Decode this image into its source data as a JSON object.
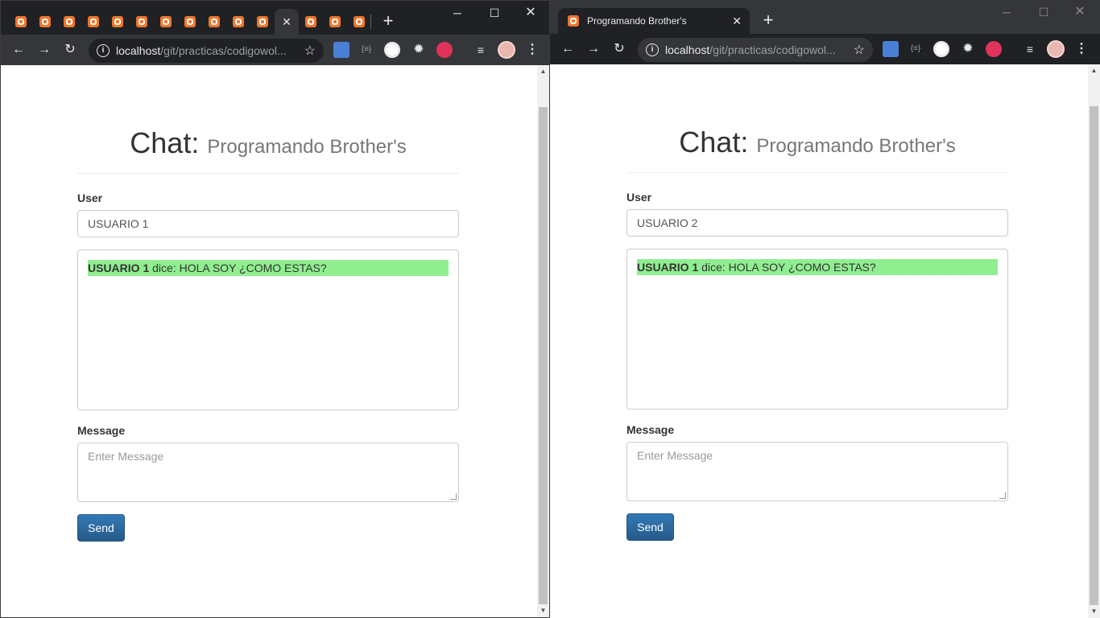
{
  "left_window": {
    "tab_close_glyph": "✕",
    "new_tab_glyph": "+",
    "window_controls": {
      "minimize": "─",
      "maximize": "☐",
      "close": "✕"
    },
    "address": {
      "host": "localhost",
      "path": "/git/practicas/codigowol..."
    },
    "page": {
      "title": "Chat:",
      "title_small": "Programando Brother's",
      "user_label": "User",
      "user_value": "USUARIO 1",
      "messages": [
        {
          "user": "USUARIO 1",
          "text": " dice: HOLA SOY ¿COMO ESTAS?"
        }
      ],
      "message_label": "Message",
      "message_placeholder": "Enter Message",
      "send_label": "Send"
    }
  },
  "right_window": {
    "tab_title": "Programando Brother's",
    "tab_close_glyph": "✕",
    "new_tab_glyph": "+",
    "window_controls": {
      "minimize": "─",
      "maximize": "☐",
      "close": "✕"
    },
    "address": {
      "host": "localhost",
      "path": "/git/practicas/codigowol..."
    },
    "page": {
      "title": "Chat:",
      "title_small": "Programando Brother's",
      "user_label": "User",
      "user_value": "USUARIO 2",
      "messages": [
        {
          "user": "USUARIO 1",
          "text": " dice: HOLA SOY ¿COMO ESTAS?"
        }
      ],
      "message_label": "Message",
      "message_placeholder": "Enter Message",
      "send_label": "Send"
    }
  },
  "icons": {
    "back": "back-arrow-icon",
    "forward": "forward-arrow-icon",
    "reload": "reload-icon",
    "star": "bookmark-star-icon",
    "translate": "google-translate-icon",
    "json": "json-viewer-icon",
    "owl": "owl-extension-icon",
    "gear": "gear-extension-icon",
    "hand": "stop-hand-icon",
    "playlist": "media-playlist-icon",
    "menu": "kebab-menu-icon",
    "favicon": "xampp-favicon"
  },
  "colors": {
    "chat_highlight": "#90ee90",
    "send_button": "#337ab7",
    "favicon": "#f0762b"
  }
}
